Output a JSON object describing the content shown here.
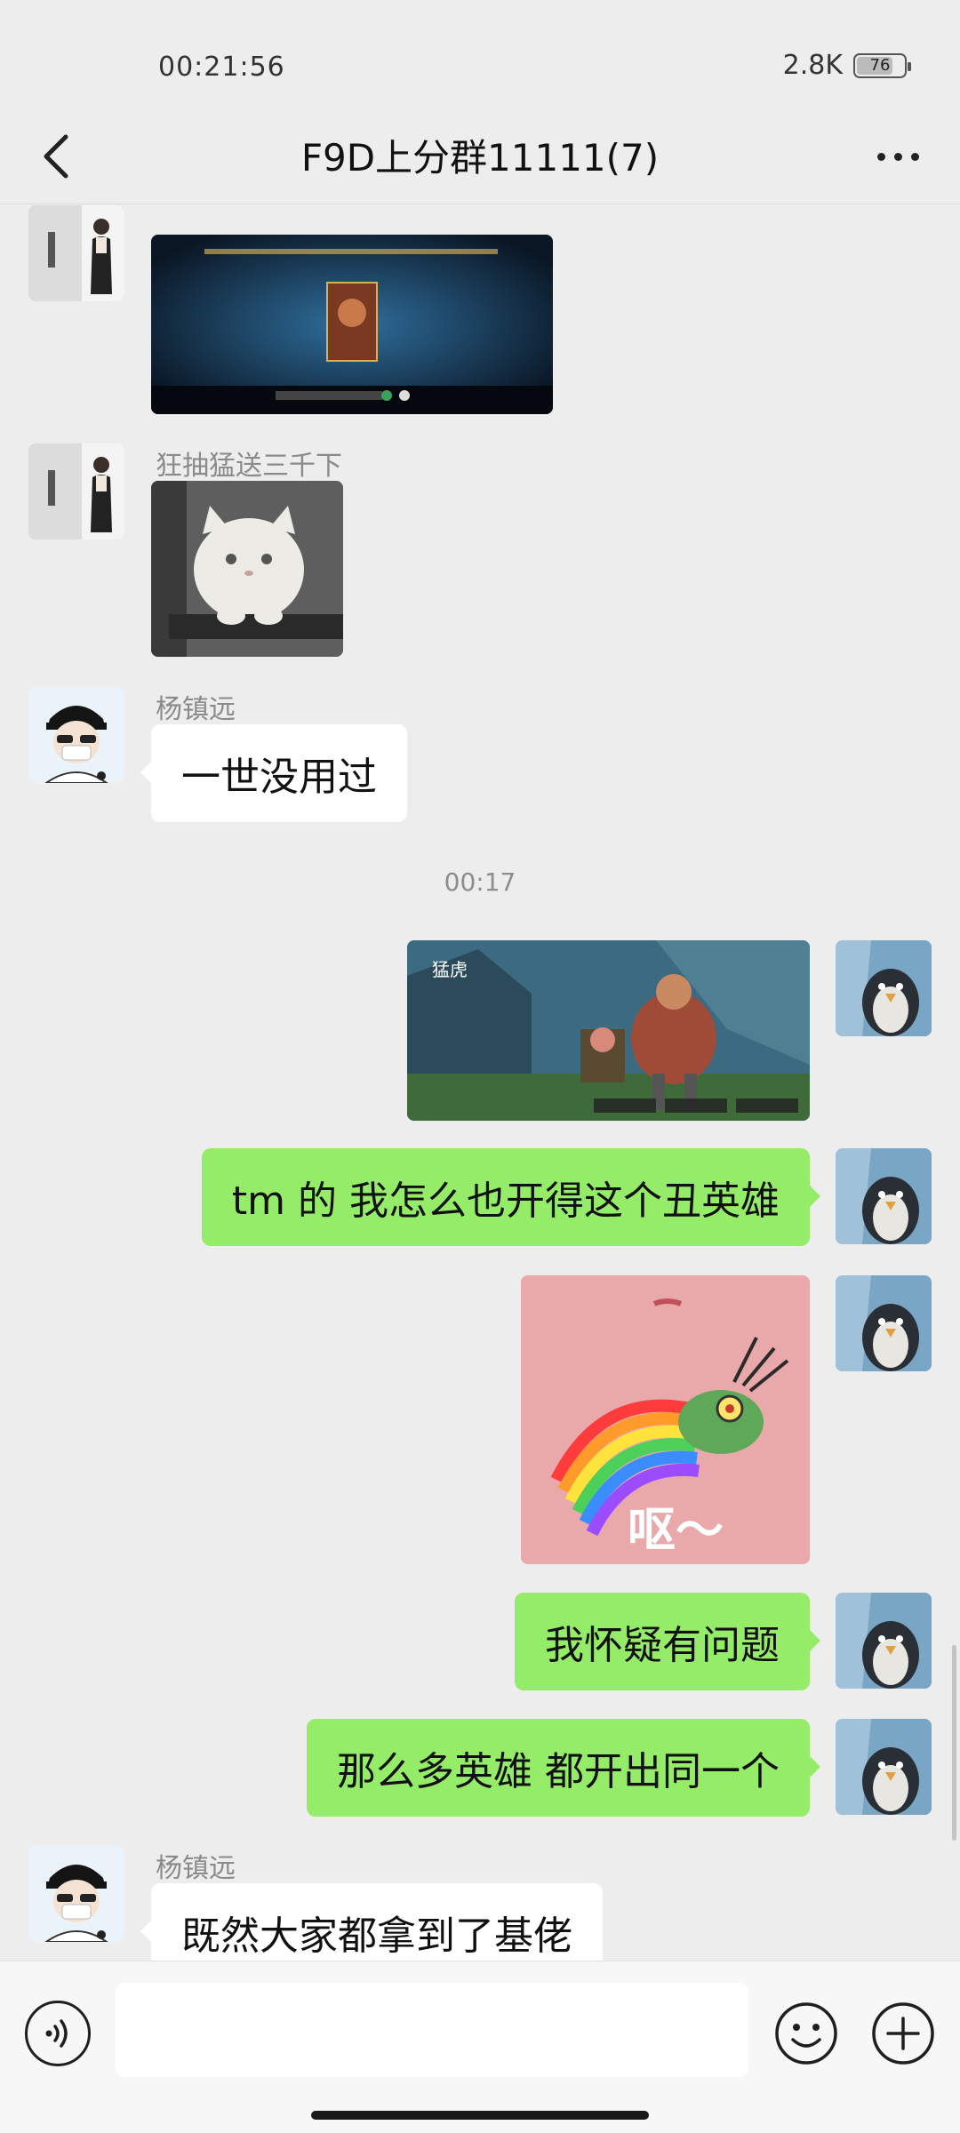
{
  "status_bar": {
    "time": "00:21:56",
    "network_speed": "2.8K",
    "battery_level": "76",
    "battery_fraction": 0.76
  },
  "header": {
    "back_icon": "chevron-left-icon",
    "title": "F9D上分群11111(7)",
    "more_icon": "more-dots-icon"
  },
  "messages": [
    {
      "side": "in",
      "sender": "狂抽猛送三千下",
      "type": "image",
      "content_icon": "game-skin-screenshot"
    },
    {
      "side": "in",
      "sender": "狂抽猛送三千下",
      "type": "image",
      "content_icon": "white-cat-sticker"
    },
    {
      "side": "in",
      "sender": "杨镇远",
      "type": "text",
      "text": "一世没用过"
    },
    {
      "type": "timestamp",
      "text": "00:17"
    },
    {
      "side": "out",
      "type": "image",
      "content_icon": "game-hero-screenshot",
      "image_caption": "猛虎"
    },
    {
      "side": "out",
      "type": "text",
      "text": "tm 的  我怎么也开得这个丑英雄"
    },
    {
      "side": "out",
      "type": "image",
      "content_icon": "plankton-rainbow-sticker",
      "image_caption": "呕～"
    },
    {
      "side": "out",
      "type": "text",
      "text": "我怀疑有问题"
    },
    {
      "side": "out",
      "type": "text",
      "text": "那么多英雄  都开出同一个"
    },
    {
      "side": "in",
      "sender": "杨镇远",
      "type": "text",
      "text": "既然大家都拿到了基佬"
    }
  ],
  "input_bar": {
    "voice_icon": "voice-icon",
    "input_value": "",
    "emoji_icon": "emoji-icon",
    "plus_icon": "plus-icon"
  },
  "colors": {
    "background": "#ededed",
    "outgoing_bubble": "#95ec69",
    "incoming_bubble": "#ffffff",
    "sender_name": "#8a8a8a"
  }
}
